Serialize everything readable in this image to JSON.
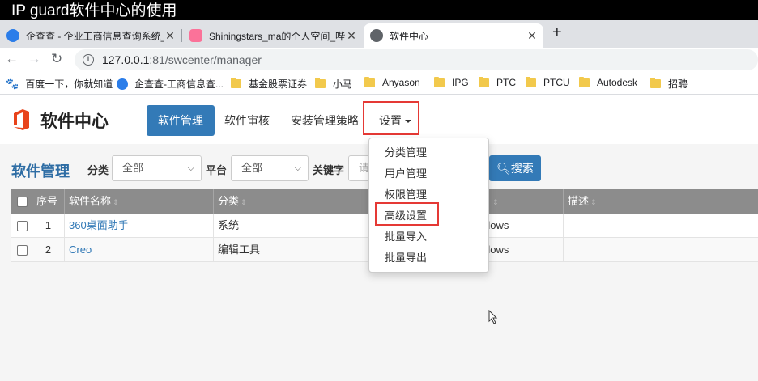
{
  "caption": "IP guard软件中心的使用",
  "tabs": [
    {
      "title": "企查查 - 企业工商信息查询系统_",
      "favicon_color": "#2b7de9"
    },
    {
      "title": "Shiningstars_ma的个人空间_哔哩",
      "favicon_color": "#fb7299"
    },
    {
      "title": "软件中心",
      "favicon_color": "#5f6368"
    }
  ],
  "address": {
    "host": "127.0.0.1",
    "rest": ":81/swcenter/manager"
  },
  "bookmarks": [
    {
      "label": "百度一下，你就知道",
      "icon": "paw-icon"
    },
    {
      "label": "企查查-工商信息查...",
      "icon": "qcc-icon"
    },
    {
      "label": "基金股票证券",
      "icon": "folder-icon"
    },
    {
      "label": "小马",
      "icon": "folder-icon"
    },
    {
      "label": "Anyason",
      "icon": "folder-icon"
    },
    {
      "label": "IPG",
      "icon": "folder-icon"
    },
    {
      "label": "PTC",
      "icon": "folder-icon"
    },
    {
      "label": "PTCU",
      "icon": "folder-icon"
    },
    {
      "label": "Autodesk",
      "icon": "folder-icon"
    },
    {
      "label": "招聘",
      "icon": "folder-icon"
    }
  ],
  "app": {
    "brand": "软件中心",
    "nav": [
      "软件管理",
      "软件审核",
      "安装管理策略",
      "设置"
    ],
    "section_title": "软件管理",
    "filters": {
      "category_label": "分类",
      "category_value": "全部",
      "platform_label": "平台",
      "platform_value": "全部",
      "keyword_label": "关键字",
      "keyword_placeholder": "请"
    },
    "search_label": "搜索",
    "table": {
      "headers": [
        "序号",
        "软件名称",
        "分类",
        "",
        "描述"
      ],
      "rows": [
        {
          "no": "1",
          "name": "360桌面助手",
          "category": "系统",
          "platform": "dows",
          "desc": ""
        },
        {
          "no": "2",
          "name": "Creo",
          "category": "编辑工具",
          "platform": "dows",
          "desc": ""
        }
      ]
    },
    "settings_menu": [
      "分类管理",
      "用户管理",
      "权限管理",
      "高级设置",
      "批量导入",
      "批量导出"
    ]
  },
  "colors": {
    "primary": "#337ab7",
    "highlight": "#e53935",
    "logo": "#e8431b"
  }
}
